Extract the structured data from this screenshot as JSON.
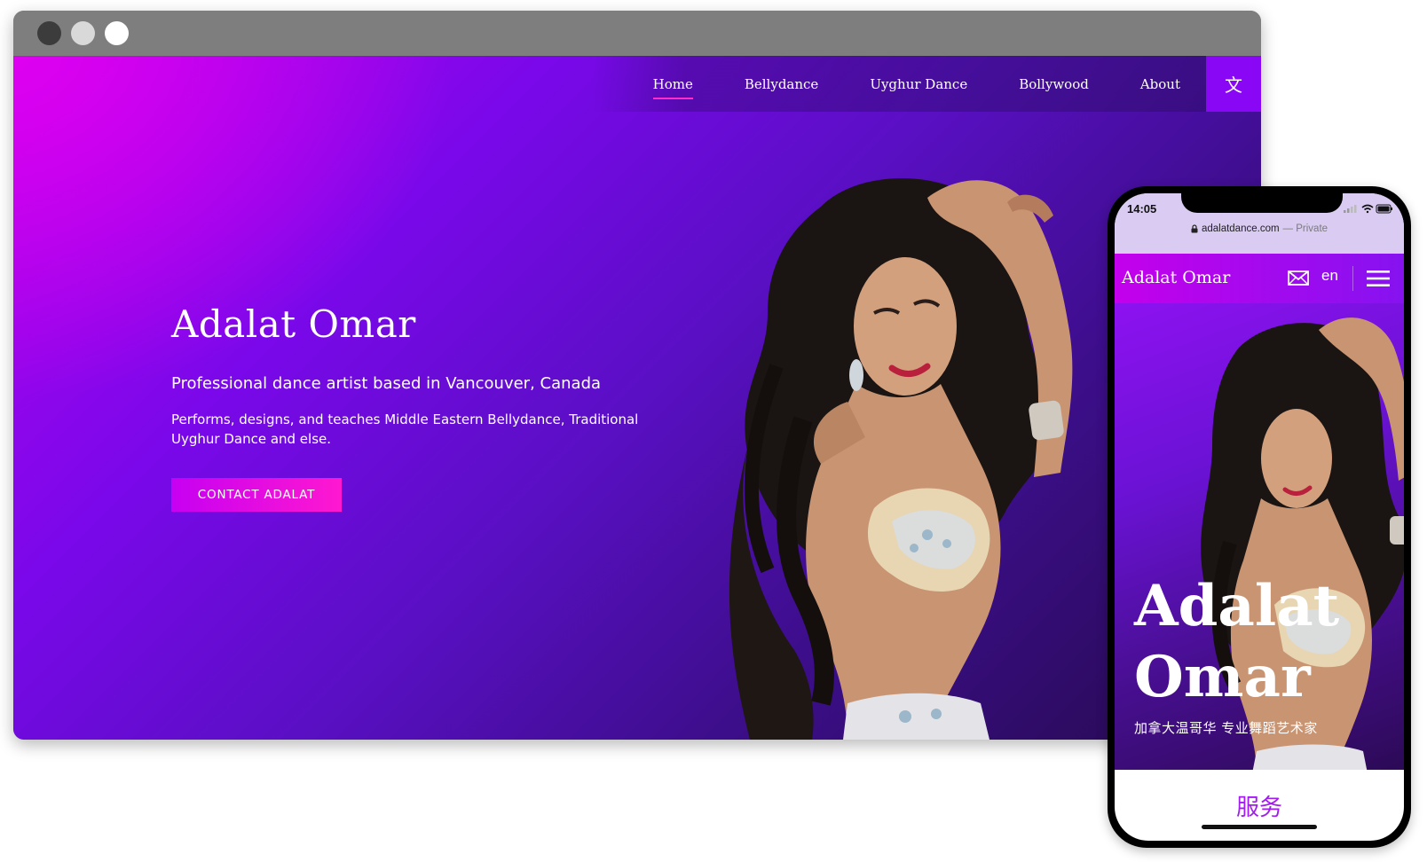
{
  "desktop": {
    "nav": {
      "items": [
        {
          "label": "Home",
          "active": true
        },
        {
          "label": "Bellydance",
          "active": false
        },
        {
          "label": "Uyghur Dance",
          "active": false
        },
        {
          "label": "Bollywood",
          "active": false
        },
        {
          "label": "About",
          "active": false
        }
      ],
      "language_button": "文"
    },
    "hero": {
      "title": "Adalat Omar",
      "subtitle": "Professional dance artist based in Vancouver, Canada",
      "description": "Performs, designs, and teaches Middle Eastern Bellydance, Traditional Uyghur Dance and else.",
      "cta_label": "CONTACT ADALAT"
    }
  },
  "mobile": {
    "status": {
      "time": "14:05"
    },
    "url": {
      "domain": "adalatdance.com",
      "private_label": "— Private"
    },
    "header": {
      "brand": "Adalat Omar",
      "language": "en"
    },
    "hero": {
      "title": "Adalat Omar",
      "subtitle": "加拿大温哥华 专业舞蹈艺术家"
    },
    "section_title": "服务"
  },
  "colors": {
    "accent_pink": "#ff18d0",
    "accent_purple": "#8a07f5",
    "section_title": "#a21cf0"
  },
  "icons": [
    "lock-icon",
    "mail-icon",
    "menu-icon",
    "language-icon",
    "signal-icon",
    "wifi-icon",
    "battery-icon"
  ]
}
